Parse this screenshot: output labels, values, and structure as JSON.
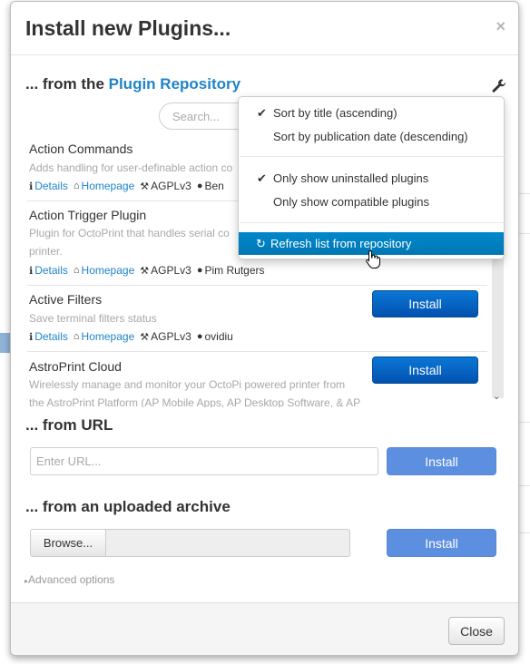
{
  "modal": {
    "title": "Install new Plugins...",
    "close_glyph": "×"
  },
  "repository": {
    "heading_prefix": "... from the ",
    "heading_link": "Plugin Repository",
    "search_placeholder": "Search...",
    "settings_icon": "wrench-icon"
  },
  "plugins": [
    {
      "name": "Action Commands",
      "desc_lines": [
        "Adds handling for user-definable action co"
      ],
      "details": "Details",
      "homepage": "Homepage",
      "license": "AGPLv3",
      "author": "Ben",
      "install": ""
    },
    {
      "name": "Action Trigger Plugin",
      "desc_lines": [
        "Plugin for OctoPrint that handles serial co",
        "printer."
      ],
      "details": "Details",
      "homepage": "Homepage",
      "license": "AGPLv3",
      "author": "Pim Rutgers",
      "install": ""
    },
    {
      "name": "Active Filters",
      "desc_lines": [
        "Save terminal filters status"
      ],
      "details": "Details",
      "homepage": "Homepage",
      "license": "AGPLv3",
      "author": "ovidiu",
      "install": "Install"
    },
    {
      "name": "AstroPrint Cloud",
      "desc_lines": [
        "Wirelessly manage and monitor your OctoPi powered printer from",
        "the AstroPrint Platform (AP Mobile Apps, AP Desktop Software, & AP"
      ],
      "install": "Install"
    }
  ],
  "from_url": {
    "heading": "... from URL",
    "placeholder": "Enter URL...",
    "install": "Install"
  },
  "from_archive": {
    "heading": "... from an uploaded archive",
    "browse": "Browse...",
    "install": "Install"
  },
  "advanced": "Advanced options",
  "footer": {
    "close": "Close"
  },
  "dropdown": {
    "sort_title": {
      "label": "Sort by title (ascending)",
      "checked": true
    },
    "sort_date": {
      "label": "Sort by publication date (descending)",
      "checked": false
    },
    "show_uninstalled": {
      "label": "Only show uninstalled plugins",
      "checked": true
    },
    "show_compatible": {
      "label": "Only show compatible plugins",
      "checked": false
    },
    "refresh": {
      "label": "Refresh list from repository",
      "highlighted": true
    }
  },
  "colors": {
    "accent": "#1f84c8",
    "primary_button": "#0a6fce",
    "disabled_button": "#5d8fe0",
    "menu_highlight": "#0081c2"
  }
}
